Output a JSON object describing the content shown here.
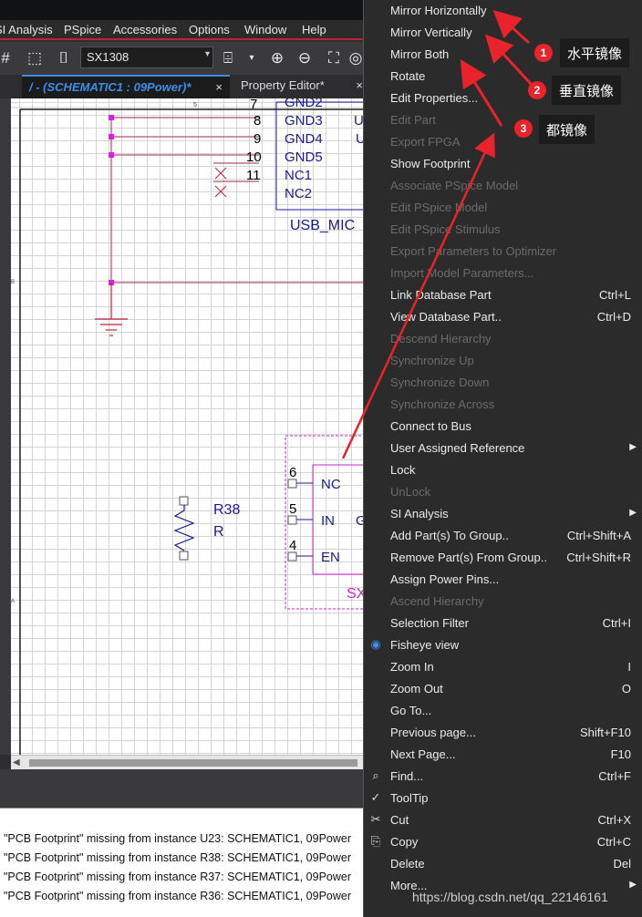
{
  "menubar": [
    "SI Analysis",
    "PSpice",
    "Accessories",
    "Options",
    "Window",
    "Help"
  ],
  "toolbar": {
    "part_combo": "SX1308"
  },
  "tabs": [
    {
      "label": "/ - (SCHEMATIC1 : 09Power)*",
      "close": "×"
    },
    {
      "label": "Property Editor*",
      "close": "×"
    }
  ],
  "schematic": {
    "ruler_top": "5",
    "ruler_left": [
      "B",
      "A"
    ],
    "usb_pins": [
      {
        "num": "7",
        "name": "GND2"
      },
      {
        "num": "8",
        "name": "GND3"
      },
      {
        "num": "9",
        "name": "GND4"
      },
      {
        "num": "10",
        "name": "GND5"
      },
      {
        "num": "11",
        "name": "NC1"
      },
      {
        "num": "",
        "name": "NC2"
      }
    ],
    "usb_partial": [
      "U",
      "U"
    ],
    "usb_ref": "USB_MIC",
    "resistor": {
      "ref": "R38",
      "value": "R"
    },
    "sx_pins": [
      {
        "num": "6",
        "name": "NC"
      },
      {
        "num": "5",
        "name": "IN"
      },
      {
        "num": "4",
        "name": "EN"
      }
    ],
    "sx_partial": "SX",
    "sx_side": "G"
  },
  "log": [
    "\"PCB Footprint\" missing from instance U23: SCHEMATIC1, 09Power",
    "\"PCB Footprint\" missing from instance R38: SCHEMATIC1, 09Power",
    "\"PCB Footprint\" missing from instance R37: SCHEMATIC1, 09Power",
    "\"PCB Footprint\" missing from instance R36: SCHEMATIC1, 09Power"
  ],
  "context_menu": [
    {
      "label": "Mirror Horizontally",
      "shortcut": "",
      "enabled": true
    },
    {
      "label": "Mirror Vertically",
      "shortcut": "",
      "enabled": true
    },
    {
      "label": "Mirror Both",
      "shortcut": "",
      "enabled": true
    },
    {
      "label": "Rotate",
      "shortcut": "",
      "enabled": true
    },
    {
      "label": "Edit Properties...",
      "shortcut": "",
      "enabled": true
    },
    {
      "label": "Edit Part",
      "shortcut": "",
      "enabled": false
    },
    {
      "label": "Export FPGA",
      "shortcut": "",
      "enabled": false
    },
    {
      "label": "Show Footprint",
      "shortcut": "",
      "enabled": true
    },
    {
      "label": "Associate PSpice Model",
      "shortcut": "",
      "enabled": false
    },
    {
      "label": "Edit PSpice Model",
      "shortcut": "",
      "enabled": false
    },
    {
      "label": "Edit PSpice Stimulus",
      "shortcut": "",
      "enabled": false
    },
    {
      "label": "Export Parameters to Optimizer",
      "shortcut": "",
      "enabled": false
    },
    {
      "label": "Import Model Parameters...",
      "shortcut": "",
      "enabled": false
    },
    {
      "label": "Link Database Part",
      "shortcut": "Ctrl+L",
      "enabled": true
    },
    {
      "label": "View Database Part..",
      "shortcut": "Ctrl+D",
      "enabled": true
    },
    {
      "label": "Descend Hierarchy",
      "shortcut": "",
      "enabled": false
    },
    {
      "label": "Synchronize Up",
      "shortcut": "",
      "enabled": false
    },
    {
      "label": "Synchronize Down",
      "shortcut": "",
      "enabled": false
    },
    {
      "label": "Synchronize Across",
      "shortcut": "",
      "enabled": false
    },
    {
      "label": "Connect to Bus",
      "shortcut": "",
      "enabled": true
    },
    {
      "label": "User Assigned Reference",
      "shortcut": "",
      "enabled": true,
      "submenu": true
    },
    {
      "label": "Lock",
      "shortcut": "",
      "enabled": true
    },
    {
      "label": "UnLock",
      "shortcut": "",
      "enabled": false
    },
    {
      "label": "SI Analysis",
      "shortcut": "",
      "enabled": true,
      "submenu": true
    },
    {
      "label": "Add Part(s) To Group..",
      "shortcut": "Ctrl+Shift+A",
      "enabled": true
    },
    {
      "label": "Remove Part(s) From Group..",
      "shortcut": "Ctrl+Shift+R",
      "enabled": true
    },
    {
      "label": "Assign Power Pins...",
      "shortcut": "",
      "enabled": true
    },
    {
      "label": "Ascend Hierarchy",
      "shortcut": "",
      "enabled": false
    },
    {
      "label": "Selection Filter",
      "shortcut": "Ctrl+I",
      "enabled": true
    },
    {
      "label": "Fisheye view",
      "shortcut": "",
      "enabled": true,
      "icon": "fisheye-icon"
    },
    {
      "label": "Zoom In",
      "shortcut": "I",
      "enabled": true
    },
    {
      "label": "Zoom Out",
      "shortcut": "O",
      "enabled": true
    },
    {
      "label": "Go To...",
      "shortcut": "",
      "enabled": true
    },
    {
      "label": "Previous page...",
      "shortcut": "Shift+F10",
      "enabled": true
    },
    {
      "label": "Next Page...",
      "shortcut": "F10",
      "enabled": true
    },
    {
      "label": "Find...",
      "shortcut": "Ctrl+F",
      "enabled": true,
      "icon": "find-icon"
    },
    {
      "label": "ToolTip",
      "shortcut": "",
      "enabled": true,
      "icon": "check-icon"
    },
    {
      "label": "Cut",
      "shortcut": "Ctrl+X",
      "enabled": true,
      "icon": "scissors-icon"
    },
    {
      "label": "Copy",
      "shortcut": "Ctrl+C",
      "enabled": true,
      "icon": "copy-icon"
    },
    {
      "label": "Delete",
      "shortcut": "Del",
      "enabled": true
    },
    {
      "label": "More...",
      "shortcut": "",
      "enabled": true,
      "submenu": true
    }
  ],
  "callouts": [
    {
      "badge": "1",
      "text": "水平镜像"
    },
    {
      "badge": "2",
      "text": "垂直镜像"
    },
    {
      "badge": "3",
      "text": "都镜像"
    }
  ],
  "watermark": "https://blog.csdn.net/qq_22146161",
  "colors": {
    "accent": "#c0203a",
    "wire": "#9a2a4a",
    "part": "#1a1a8c",
    "annotation": "#e8232b"
  }
}
